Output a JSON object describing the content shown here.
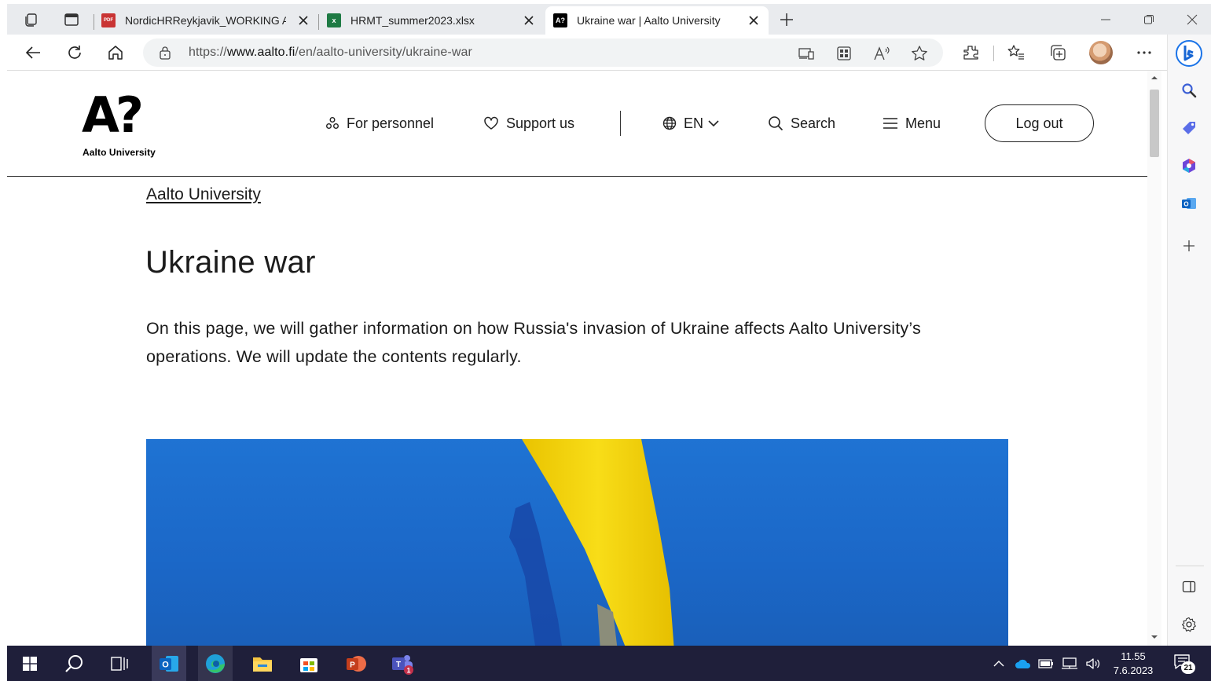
{
  "browser": {
    "tabs": [
      {
        "label": "NordicHRReykjavik_WORKING AI",
        "icon": "pdf-icon",
        "active": false
      },
      {
        "label": "HRMT_summer2023.xlsx",
        "icon": "excel-icon",
        "active": false
      },
      {
        "label": "Ukraine war | Aalto University",
        "icon": "aalto-favicon",
        "active": true
      }
    ],
    "url_prefix": "https://",
    "url_host": "www.aalto.fi",
    "url_path": "/en/aalto-university/ukraine-war",
    "favicon_text": "A?"
  },
  "site": {
    "logo_mark": "A?",
    "logo_text": "Aalto University",
    "nav": {
      "personnel": "For personnel",
      "support": "Support us",
      "language": "EN",
      "search": "Search",
      "menu": "Menu",
      "logout": "Log out"
    }
  },
  "page": {
    "breadcrumb": "Aalto University",
    "title": "Ukraine war",
    "lead": "On this page, we will gather information on how Russia's invasion of Ukraine affects Aalto University’s operations. We will update the contents regularly."
  },
  "taskbar": {
    "time": "11.55",
    "date": "7.6.2023",
    "notifications": "21",
    "teams_badge": "1",
    "outlook_letter": "O",
    "powerpoint_letter": "P",
    "teams_letter": "T",
    "excel_letter": "x",
    "pdf_letter": "PDF"
  },
  "colors": {
    "flag_blue": "#1f6fd0",
    "flag_yellow": "#f6d40f",
    "taskbar": "#1f1f3a"
  }
}
